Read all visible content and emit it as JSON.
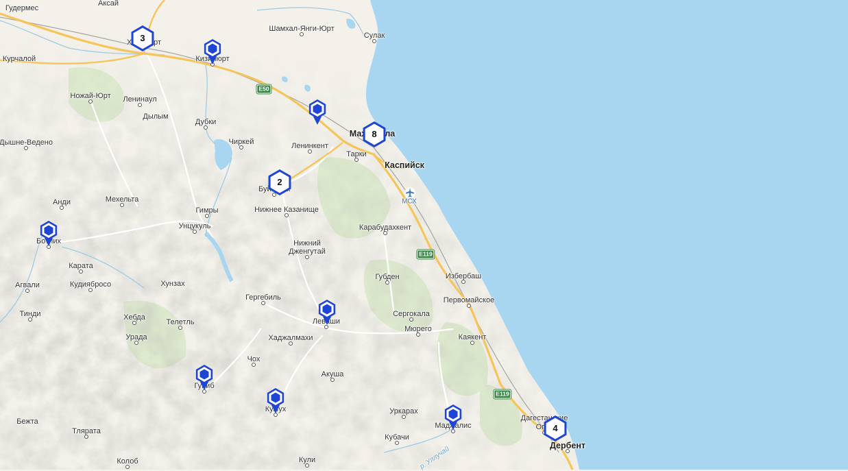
{
  "map": {
    "colors": {
      "sea": "#a8d6f0",
      "land": "#f3f1ea",
      "highway": "#f6c559",
      "marker": "#1f45d4",
      "forest": "#d7e8c6"
    },
    "places": [
      {
        "id": "gudermes",
        "name": "Гудермес"
      },
      {
        "id": "aksai",
        "name": "Аксай"
      },
      {
        "id": "khasavyurt",
        "name": "Хасавюрт"
      },
      {
        "id": "kurchaloi",
        "name": "Курчалой"
      },
      {
        "id": "kizilyurt",
        "name": "Кизилюрт"
      },
      {
        "id": "shamkhal",
        "name": "Шамхал-Янги-Юрт"
      },
      {
        "id": "sulak",
        "name": "Сулак"
      },
      {
        "id": "nozhai",
        "name": "Ножай-Юрт"
      },
      {
        "id": "leninaul",
        "name": "Ленинаул"
      },
      {
        "id": "dylym",
        "name": "Дылым"
      },
      {
        "id": "dubki",
        "name": "Дубки"
      },
      {
        "id": "chirkei",
        "name": "Чиркей"
      },
      {
        "id": "dyshne",
        "name": "Дышне-Ведено"
      },
      {
        "id": "makhachkala",
        "name": "Махачкала"
      },
      {
        "id": "leninkent",
        "name": "Ленинкент"
      },
      {
        "id": "tarki",
        "name": "Тарки"
      },
      {
        "id": "kaspiysk",
        "name": "Каспийск"
      },
      {
        "id": "buynaksk",
        "name": "Буйнакск"
      },
      {
        "id": "andi",
        "name": "Анди"
      },
      {
        "id": "mekhelta",
        "name": "Мехельта"
      },
      {
        "id": "gimry",
        "name": "Гимры"
      },
      {
        "id": "nizhkazan",
        "name": "Нижнее Казанище"
      },
      {
        "id": "untsukul",
        "name": "Унцукуль"
      },
      {
        "id": "karabud",
        "name": "Карабудахкент"
      },
      {
        "id": "botlikh",
        "name": "Ботлих"
      },
      {
        "id": "nizhdzhen1",
        "name": "Нижний"
      },
      {
        "id": "nizhdzhen2",
        "name": "Дженгутай"
      },
      {
        "id": "karata",
        "name": "Карата"
      },
      {
        "id": "agvali",
        "name": "Агвали"
      },
      {
        "id": "kudiyab",
        "name": "Кудиябросо"
      },
      {
        "id": "khunzakh",
        "name": "Хунзах"
      },
      {
        "id": "gubden",
        "name": "Губден"
      },
      {
        "id": "izberbash",
        "name": "Избербаш"
      },
      {
        "id": "gergebil",
        "name": "Гергебиль"
      },
      {
        "id": "pervomai",
        "name": "Первомайское"
      },
      {
        "id": "tindi",
        "name": "Тинди"
      },
      {
        "id": "khebda",
        "name": "Хебда"
      },
      {
        "id": "teletl",
        "name": "Телетль"
      },
      {
        "id": "levashi",
        "name": "Леваши"
      },
      {
        "id": "sergokala",
        "name": "Сергокала"
      },
      {
        "id": "khadzhal",
        "name": "Хаджалмахи"
      },
      {
        "id": "myurego",
        "name": "Мюрего"
      },
      {
        "id": "urada",
        "name": "Урада"
      },
      {
        "id": "kayakent",
        "name": "Каякент"
      },
      {
        "id": "chokh",
        "name": "Чох"
      },
      {
        "id": "akusha",
        "name": "Акуша"
      },
      {
        "id": "tsunib",
        "name": "Гуниб"
      },
      {
        "id": "kubachi2",
        "name": "Кумух"
      },
      {
        "id": "urkarakh",
        "name": "Уркарах"
      },
      {
        "id": "dagogni1",
        "name": "Дагестанские"
      },
      {
        "id": "dagogni2",
        "name": "Огни"
      },
      {
        "id": "madzhalis",
        "name": "Маджалис"
      },
      {
        "id": "bezhta",
        "name": "Бежта"
      },
      {
        "id": "tlyarata",
        "name": "Тлярата"
      },
      {
        "id": "kubachi",
        "name": "Кубачи"
      },
      {
        "id": "derbent",
        "name": "Дербент"
      },
      {
        "id": "kolob",
        "name": "Колоб"
      },
      {
        "id": "kuli",
        "name": "Кули"
      }
    ],
    "road_shields": [
      {
        "id": "e50",
        "label": "E50"
      },
      {
        "id": "e119a",
        "label": "E119"
      },
      {
        "id": "e119b",
        "label": "E119"
      }
    ],
    "airport": {
      "code": "МСХ",
      "icon": "airplane-icon"
    },
    "river": {
      "name": "р. Уллучай"
    },
    "pins": [
      {
        "id": "kizilyurt",
        "icon": "hexagon-pin-icon"
      },
      {
        "id": "makhach-west",
        "icon": "hexagon-pin-icon"
      },
      {
        "id": "botlikh",
        "icon": "hexagon-pin-icon"
      },
      {
        "id": "levashi",
        "icon": "hexagon-pin-icon"
      },
      {
        "id": "gunib",
        "icon": "hexagon-pin-icon"
      },
      {
        "id": "kumukh",
        "icon": "hexagon-pin-icon"
      },
      {
        "id": "madzhalis",
        "icon": "hexagon-pin-icon"
      }
    ],
    "clusters": [
      {
        "id": "khasavyurt",
        "count": "3"
      },
      {
        "id": "makhachkala",
        "count": "8"
      },
      {
        "id": "buynaksk",
        "count": "2"
      },
      {
        "id": "derbent",
        "count": "4"
      }
    ]
  }
}
